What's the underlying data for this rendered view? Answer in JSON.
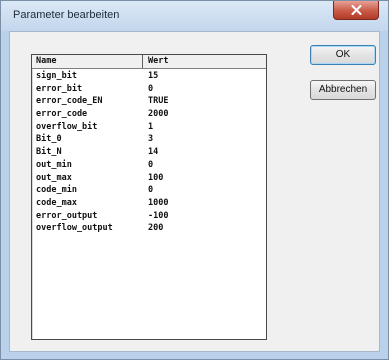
{
  "dialog": {
    "title": "Parameter bearbeiten"
  },
  "table": {
    "headers": {
      "name": "Name",
      "value": "Wert"
    },
    "rows": [
      {
        "name": "sign_bit",
        "value": "15"
      },
      {
        "name": "error_bit",
        "value": "0"
      },
      {
        "name": "error_code_EN",
        "value": "TRUE"
      },
      {
        "name": "error_code",
        "value": "2000"
      },
      {
        "name": "overflow_bit",
        "value": "1"
      },
      {
        "name": "Bit_0",
        "value": "3"
      },
      {
        "name": "Bit_N",
        "value": "14"
      },
      {
        "name": "out_min",
        "value": "0"
      },
      {
        "name": "out_max",
        "value": "100"
      },
      {
        "name": "code_min",
        "value": "0"
      },
      {
        "name": "code_max",
        "value": "1000"
      },
      {
        "name": "error_output",
        "value": "-100"
      },
      {
        "name": "overflow_output",
        "value": "200"
      }
    ]
  },
  "buttons": {
    "ok": "OK",
    "cancel": "Abbrechen"
  },
  "icons": {
    "close": "close-icon"
  },
  "colors": {
    "frame": "#b9d1ea",
    "close_button": "#c95a47",
    "dialog_background": "#f0f0f0",
    "grid_background": "#ffffff"
  }
}
